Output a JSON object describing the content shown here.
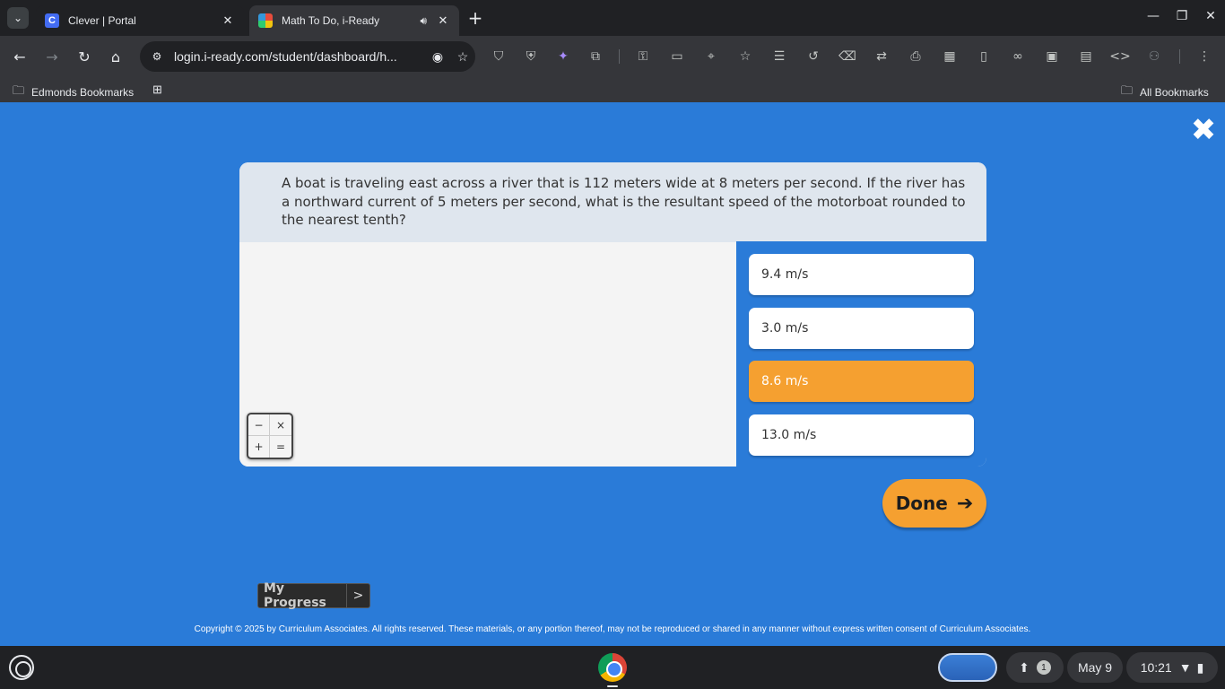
{
  "browser": {
    "tabs": [
      {
        "title": "Clever | Portal",
        "favicon": "C",
        "active": false
      },
      {
        "title": "Math To Do, i-Ready",
        "active": true
      }
    ],
    "omnibox": {
      "url": "login.i-ready.com/student/dashboard/h..."
    },
    "bookmarks": {
      "left": "Edmonds Bookmarks",
      "right": "All Bookmarks"
    }
  },
  "lesson": {
    "close_icon": "✖",
    "question": "A boat is traveling east across a river that is 112 meters wide at 8 meters per second. If the river has a northward current of 5 meters per second, what is the resultant speed of the motorboat rounded to the nearest tenth?",
    "answers": [
      {
        "label": "9.4 m/s",
        "selected": false
      },
      {
        "label": "3.0 m/s",
        "selected": false
      },
      {
        "label": "8.6 m/s",
        "selected": true
      },
      {
        "label": "13.0 m/s",
        "selected": false
      }
    ],
    "calculator": [
      "−",
      "×",
      "+",
      "="
    ],
    "done_label": "Done",
    "done_arrow": "➔",
    "progress_label": "My Progress",
    "progress_chevron": ">",
    "copyright": "Copyright © 2025 by Curriculum Associates. All rights reserved. These materials, or any portion thereof, may not be reproduced or shared in any manner without express written consent of Curriculum Associates.",
    "colors": {
      "background": "#2a7bd8",
      "accent": "#f5a030"
    }
  },
  "shelf": {
    "date": "May 9",
    "time": "10:21",
    "notification_count": "1"
  }
}
